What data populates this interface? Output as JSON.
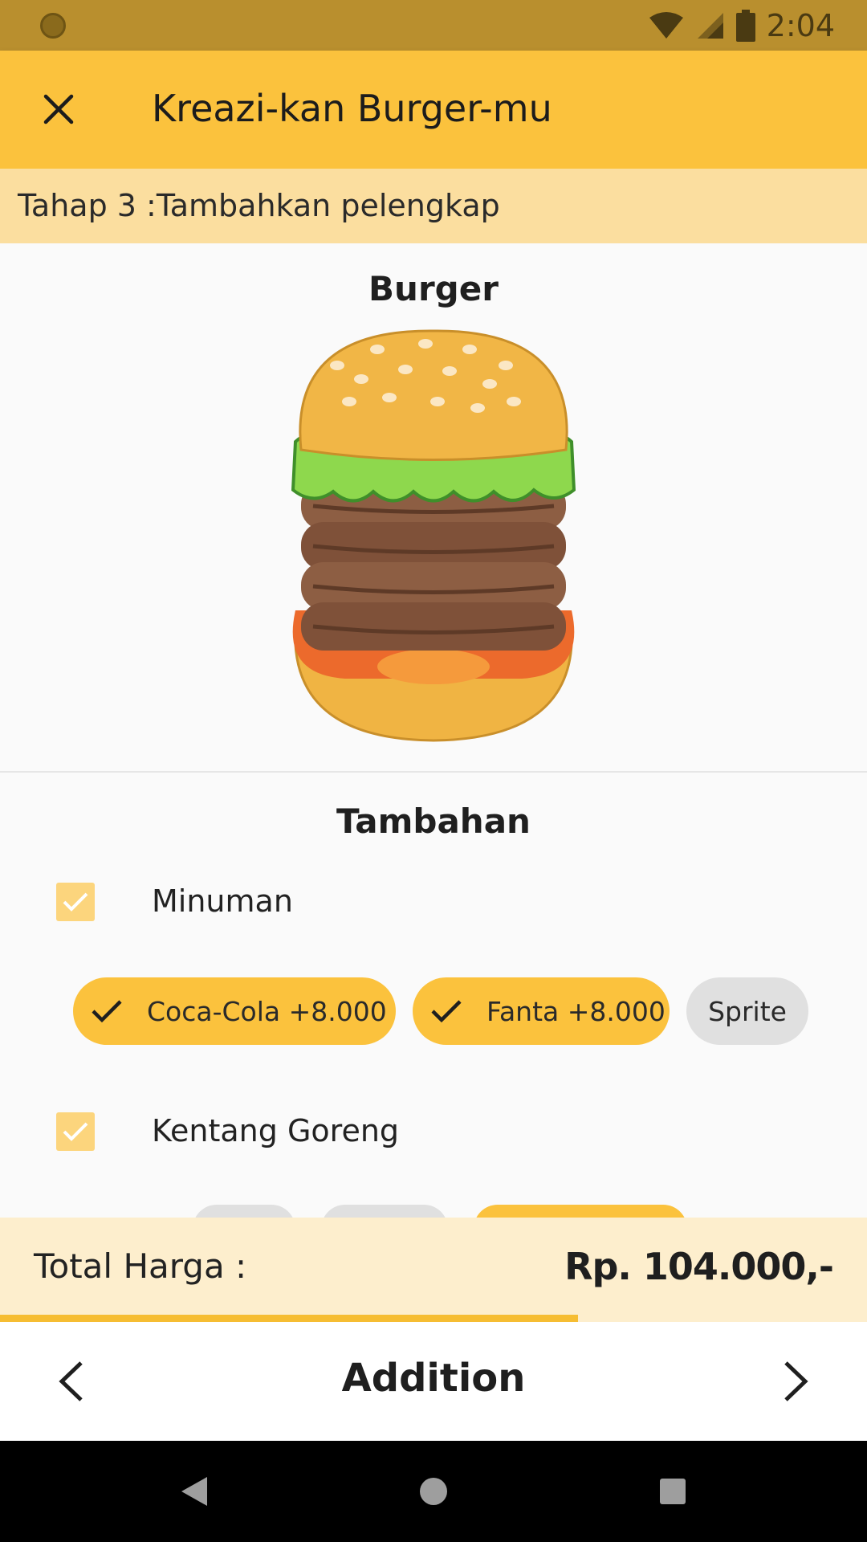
{
  "status": {
    "time": "2:04"
  },
  "appbar": {
    "title": "Kreazi-kan Burger-mu"
  },
  "step": {
    "text": "Tahap 3 :Tambahkan pelengkap"
  },
  "preview": {
    "title": "Burger"
  },
  "addons": {
    "title": "Tambahan",
    "groups": [
      {
        "label": "Minuman",
        "checked": true
      },
      {
        "label": "Kentang Goreng",
        "checked": true
      }
    ],
    "drinks": [
      {
        "label": "Coca-Cola +8.000",
        "selected": true
      },
      {
        "label": "Fanta +8.000",
        "selected": true
      },
      {
        "label": "Sprite",
        "selected": false
      }
    ]
  },
  "total": {
    "label": "Total Harga :",
    "value": "Rp. 104.000,-"
  },
  "progress": {
    "fraction": 0.667
  },
  "bottom_nav": {
    "title": "Addition"
  },
  "colors": {
    "accent": "#fbc23d",
    "accent_light": "#fbde9f",
    "status_bar": "#b98f2e"
  }
}
